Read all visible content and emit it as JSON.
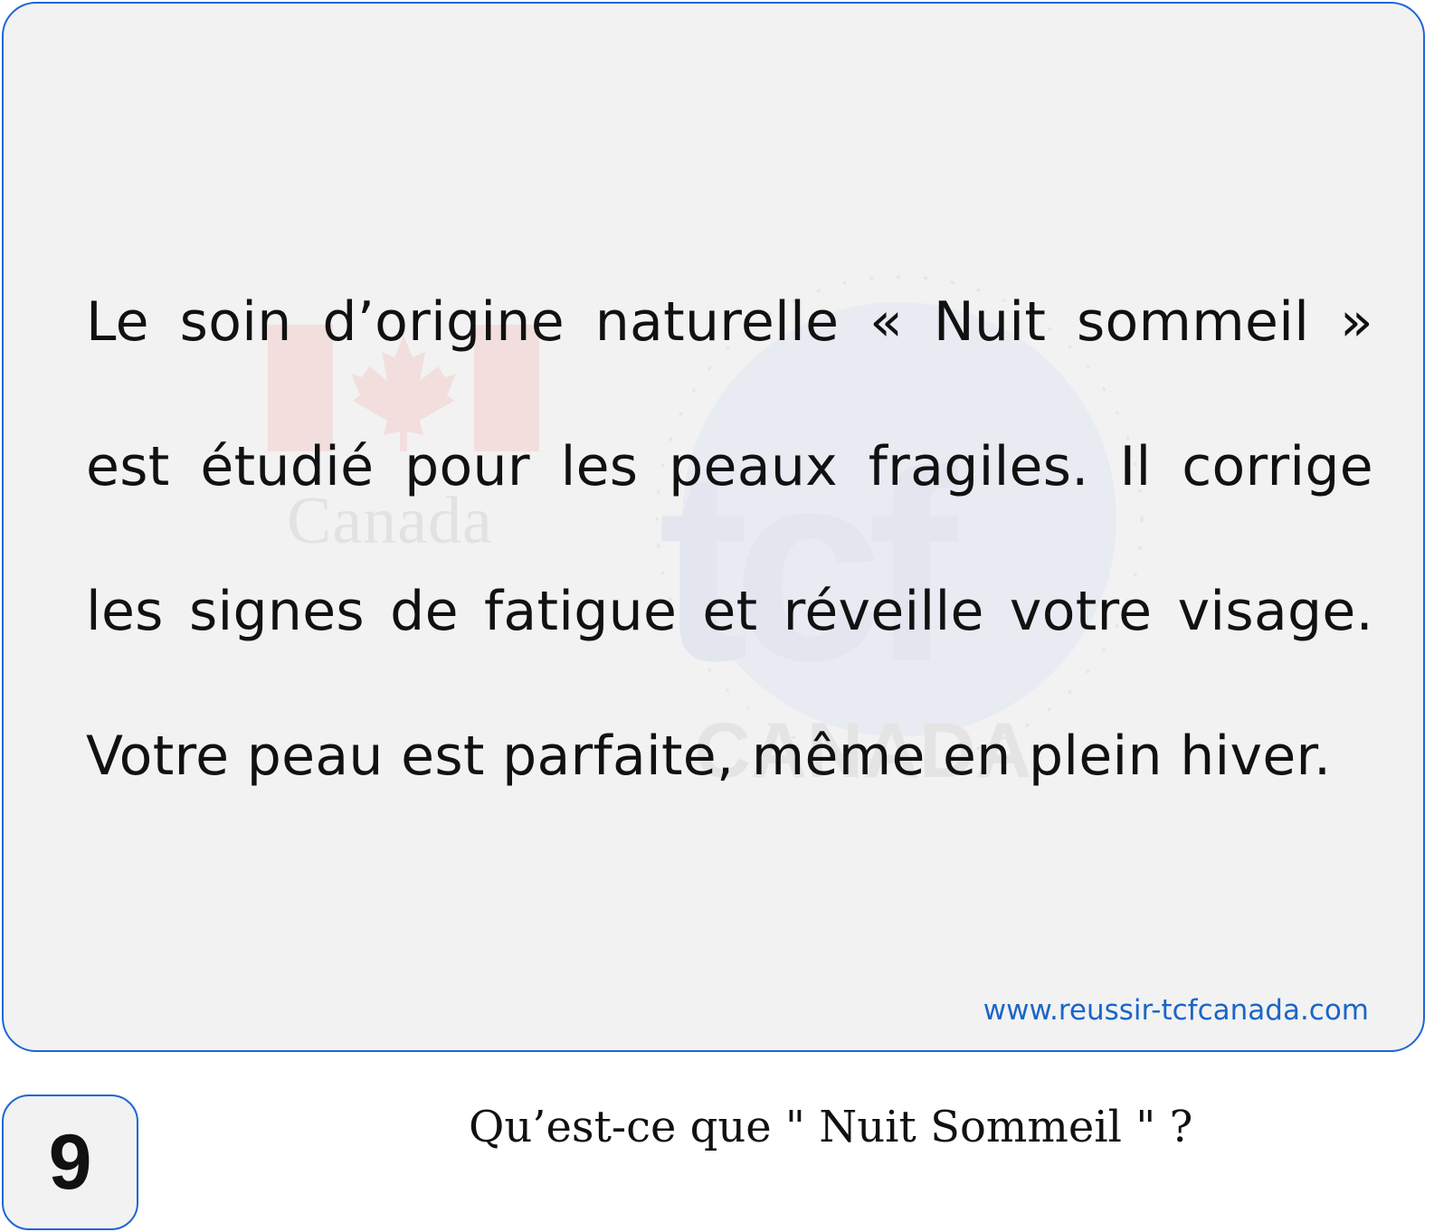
{
  "card": {
    "passage": "Le soin d’origine naturelle « Nuit sommeil » est étudié pour les peaux fragiles. Il corrige les signes de fatigue et réveille votre visage. Votre peau est parfaite, même en plein hiver.",
    "website": "www.reussir-tcfcanada.com"
  },
  "watermark": {
    "left_text": "Canada",
    "logo_text": "tcf",
    "logo_subtext": "CANADA"
  },
  "question": {
    "number": "9",
    "text": "Qu’est-ce que \" Nuit Sommeil \" ?"
  },
  "colors": {
    "border": "#1f65d6",
    "card_bg": "#f2f2f2",
    "link": "#1a66c8"
  }
}
